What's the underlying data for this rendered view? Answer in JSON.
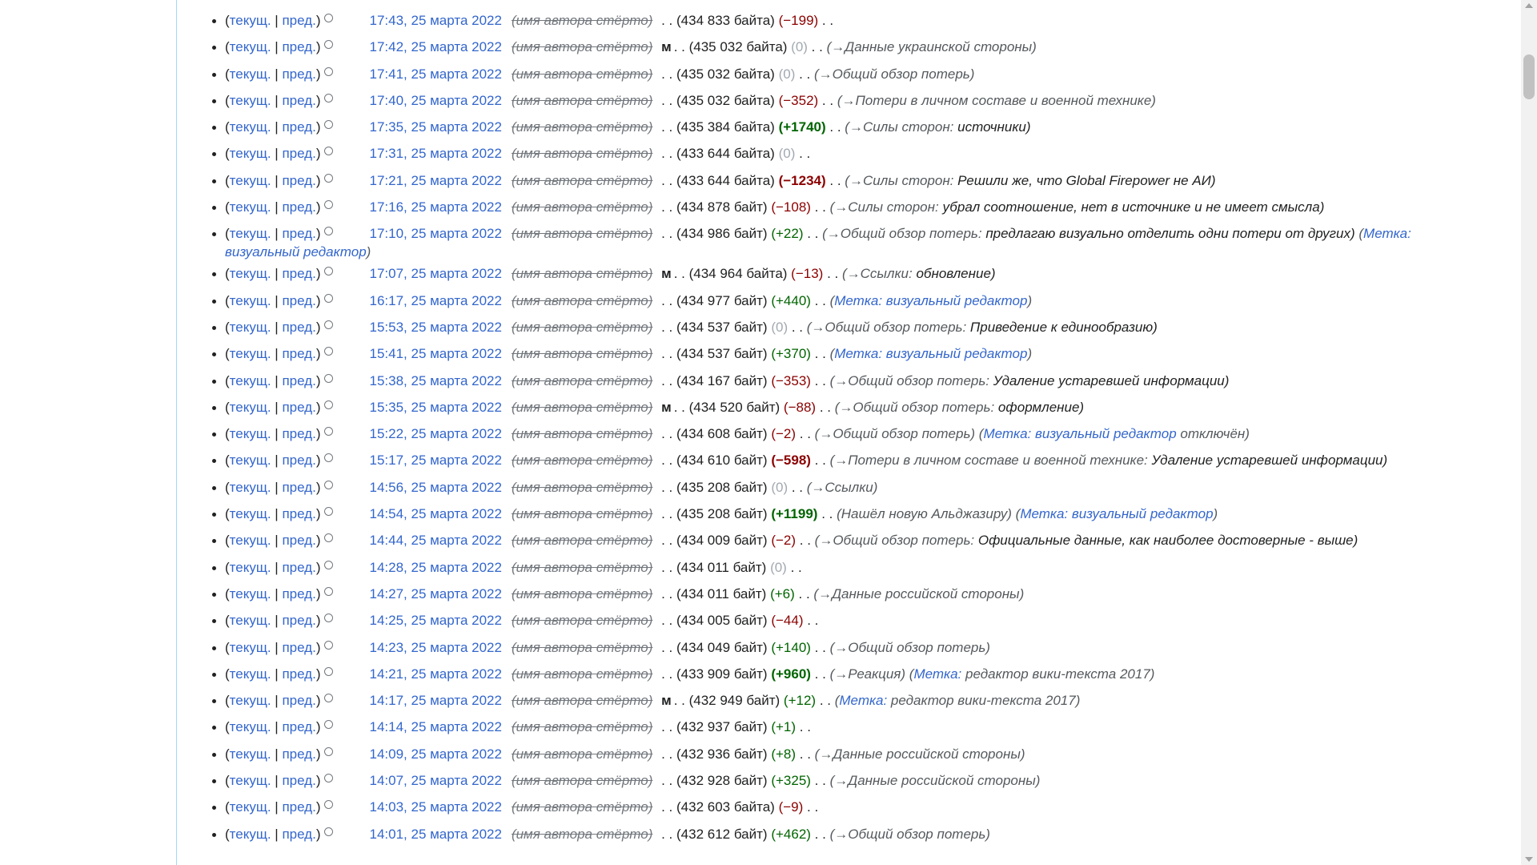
{
  "rows": [
    {
      "time": "17:43, 25 марта 2022",
      "minor": "",
      "size": "(434 833 байта)",
      "diff": "(−199)",
      "diff_class": "neg",
      "section": "",
      "summary": "",
      "tag_label": "",
      "tag_value": "",
      "tag_suffix": ""
    },
    {
      "time": "17:42, 25 марта 2022",
      "minor": "м",
      "size": "(435 032 байта)",
      "diff": "(0)",
      "diff_class": "null",
      "section": "(→Данные украинской стороны)",
      "summary": "",
      "tag_label": "",
      "tag_value": "",
      "tag_suffix": ""
    },
    {
      "time": "17:41, 25 марта 2022",
      "minor": "",
      "size": "(435 032 байта)",
      "diff": "(0)",
      "diff_class": "null",
      "section": "(→Общий обзор потерь)",
      "summary": "",
      "tag_label": "",
      "tag_value": "",
      "tag_suffix": ""
    },
    {
      "time": "17:40, 25 марта 2022",
      "minor": "",
      "size": "(435 032 байта)",
      "diff": "(−352)",
      "diff_class": "neg",
      "section": "(→Потери в личном составе и военной технике)",
      "summary": "",
      "tag_label": "",
      "tag_value": "",
      "tag_suffix": ""
    },
    {
      "time": "17:35, 25 марта 2022",
      "minor": "",
      "size": "(435 384 байта)",
      "diff": "(+1740)",
      "diff_class": "pos strong",
      "section": "(→Силы сторон:",
      "summary": "источники)",
      "tag_label": "",
      "tag_value": "",
      "tag_suffix": ""
    },
    {
      "time": "17:31, 25 марта 2022",
      "minor": "",
      "size": "(433 644 байта)",
      "diff": "(0)",
      "diff_class": "null",
      "section": "",
      "summary": "",
      "tag_label": "",
      "tag_value": "",
      "tag_suffix": ""
    },
    {
      "time": "17:21, 25 марта 2022",
      "minor": "",
      "size": "(433 644 байта)",
      "diff": "(−1234)",
      "diff_class": "neg strong",
      "section": "(→Силы сторон:",
      "summary": "Решили же, что Global Firepower не АИ)",
      "tag_label": "",
      "tag_value": "",
      "tag_suffix": ""
    },
    {
      "time": "17:16, 25 марта 2022",
      "minor": "",
      "size": "(434 878 байт)",
      "diff": "(−108)",
      "diff_class": "neg",
      "section": "(→Силы сторон:",
      "summary": "убрал соотношение, нет в источнике и не имеет смысла)",
      "tag_label": "",
      "tag_value": "",
      "tag_suffix": ""
    },
    {
      "time": "17:10, 25 марта 2022",
      "minor": "",
      "size": "(434 986 байт)",
      "diff": "(+22)",
      "diff_class": "pos",
      "section": "(→Общий обзор потерь:",
      "summary": "предлагаю визуально отделить одни потери от других)",
      "tag_label": "Метка: визуальный редактор",
      "tag_value": "",
      "tag_suffix": "",
      "tall": true
    },
    {
      "time": "17:07, 25 марта 2022",
      "minor": "м",
      "size": "(434 964 байта)",
      "diff": "(−13)",
      "diff_class": "neg",
      "section": "(→Ссылки:",
      "summary": "обновление)",
      "tag_label": "",
      "tag_value": "",
      "tag_suffix": ""
    },
    {
      "time": "16:17, 25 марта 2022",
      "minor": "",
      "size": "(434 977 байт)",
      "diff": "(+440)",
      "diff_class": "pos",
      "section": "",
      "summary": "",
      "tag_label": "Метка: визуальный редактор",
      "tag_value": "",
      "tag_suffix": ""
    },
    {
      "time": "15:53, 25 марта 2022",
      "minor": "",
      "size": "(434 537 байт)",
      "diff": "(0)",
      "diff_class": "null",
      "section": "(→Общий обзор потерь:",
      "summary": "Приведение к единообразию)",
      "tag_label": "",
      "tag_value": "",
      "tag_suffix": ""
    },
    {
      "time": "15:41, 25 марта 2022",
      "minor": "",
      "size": "(434 537 байт)",
      "diff": "(+370)",
      "diff_class": "pos",
      "section": "",
      "summary": "",
      "tag_label": "Метка: визуальный редактор",
      "tag_value": "",
      "tag_suffix": ""
    },
    {
      "time": "15:38, 25 марта 2022",
      "minor": "",
      "size": "(434 167 байт)",
      "diff": "(−353)",
      "diff_class": "neg",
      "section": "(→Общий обзор потерь:",
      "summary": "Удаление устаревшей информации)",
      "tag_label": "",
      "tag_value": "",
      "tag_suffix": ""
    },
    {
      "time": "15:35, 25 марта 2022",
      "minor": "м",
      "size": "(434 520 байт)",
      "diff": "(−88)",
      "diff_class": "neg",
      "section": "(→Общий обзор потерь:",
      "summary": "оформление)",
      "tag_label": "",
      "tag_value": "",
      "tag_suffix": ""
    },
    {
      "time": "15:22, 25 марта 2022",
      "minor": "",
      "size": "(434 608 байт)",
      "diff": "(−2)",
      "diff_class": "neg",
      "section": "(→Общий обзор потерь)",
      "summary": "",
      "tag_label": "Метка: визуальный редактор",
      "tag_value": "",
      "tag_suffix": "отключён)"
    },
    {
      "time": "15:17, 25 марта 2022",
      "minor": "",
      "size": "(434 610 байт)",
      "diff": "(−598)",
      "diff_class": "neg strong",
      "section": "(→Потери в личном составе и военной технике:",
      "summary": "Удаление устаревшей информации)",
      "tag_label": "",
      "tag_value": "",
      "tag_suffix": ""
    },
    {
      "time": "14:56, 25 марта 2022",
      "minor": "",
      "size": "(435 208 байт)",
      "diff": "(0)",
      "diff_class": "null",
      "section": "(→Ссылки)",
      "summary": "",
      "tag_label": "",
      "tag_value": "",
      "tag_suffix": ""
    },
    {
      "time": "14:54, 25 марта 2022",
      "minor": "",
      "size": "(435 208 байт)",
      "diff": "(+1199)",
      "diff_class": "pos strong",
      "section": "(Нашёл новую Альджазиру)",
      "summary": "",
      "tag_label": "Метка: визуальный редактор",
      "tag_value": "",
      "tag_suffix": ""
    },
    {
      "time": "14:44, 25 марта 2022",
      "minor": "",
      "size": "(434 009 байт)",
      "diff": "(−2)",
      "diff_class": "neg",
      "section": "(→Общий обзор потерь:",
      "summary": "Официальные данные, как наиболее достоверные - выше)",
      "tag_label": "",
      "tag_value": "",
      "tag_suffix": ""
    },
    {
      "time": "14:28, 25 марта 2022",
      "minor": "",
      "size": "(434 011 байт)",
      "diff": "(0)",
      "diff_class": "null",
      "section": "",
      "summary": "",
      "tag_label": "",
      "tag_value": "",
      "tag_suffix": ""
    },
    {
      "time": "14:27, 25 марта 2022",
      "minor": "",
      "size": "(434 011 байт)",
      "diff": "(+6)",
      "diff_class": "pos",
      "section": "(→Данные российской стороны)",
      "summary": "",
      "tag_label": "",
      "tag_value": "",
      "tag_suffix": ""
    },
    {
      "time": "14:25, 25 марта 2022",
      "minor": "",
      "size": "(434 005 байт)",
      "diff": "(−44)",
      "diff_class": "neg",
      "section": "",
      "summary": "",
      "tag_label": "",
      "tag_value": "",
      "tag_suffix": ""
    },
    {
      "time": "14:23, 25 марта 2022",
      "minor": "",
      "size": "(434 049 байт)",
      "diff": "(+140)",
      "diff_class": "pos",
      "section": "(→Общий обзор потерь)",
      "summary": "",
      "tag_label": "",
      "tag_value": "",
      "tag_suffix": ""
    },
    {
      "time": "14:21, 25 марта 2022",
      "minor": "",
      "size": "(433 909 байт)",
      "diff": "(+960)",
      "diff_class": "pos strong",
      "section": "(→Реакция)",
      "summary": "",
      "tag_label": "Метка:",
      "tag_value": "редактор вики-текста 2017)",
      "tag_suffix": ""
    },
    {
      "time": "14:17, 25 марта 2022",
      "minor": "м",
      "size": "(432 949 байт)",
      "diff": "(+12)",
      "diff_class": "pos",
      "section": "",
      "summary": "",
      "tag_label": "Метка:",
      "tag_value": "редактор вики-текста 2017)",
      "tag_suffix": ""
    },
    {
      "time": "14:14, 25 марта 2022",
      "minor": "",
      "size": "(432 937 байт)",
      "diff": "(+1)",
      "diff_class": "pos",
      "section": "",
      "summary": "",
      "tag_label": "",
      "tag_value": "",
      "tag_suffix": ""
    },
    {
      "time": "14:09, 25 марта 2022",
      "minor": "",
      "size": "(432 936 байт)",
      "diff": "(+8)",
      "diff_class": "pos",
      "section": "(→Данные российской стороны)",
      "summary": "",
      "tag_label": "",
      "tag_value": "",
      "tag_suffix": ""
    },
    {
      "time": "14:07, 25 марта 2022",
      "minor": "",
      "size": "(432 928 байт)",
      "diff": "(+325)",
      "diff_class": "pos",
      "section": "(→Данные российской стороны)",
      "summary": "",
      "tag_label": "",
      "tag_value": "",
      "tag_suffix": ""
    },
    {
      "time": "14:03, 25 марта 2022",
      "minor": "",
      "size": "(432 603 байта)",
      "diff": "(−9)",
      "diff_class": "neg",
      "section": "",
      "summary": "",
      "tag_label": "",
      "tag_value": "",
      "tag_suffix": ""
    },
    {
      "time": "14:01, 25 марта 2022",
      "minor": "",
      "size": "(432 612 байт)",
      "diff": "(+462)",
      "diff_class": "pos",
      "section": "(→Общий обзор потерь)",
      "summary": "",
      "tag_label": "",
      "tag_value": "",
      "tag_suffix": ""
    }
  ]
}
